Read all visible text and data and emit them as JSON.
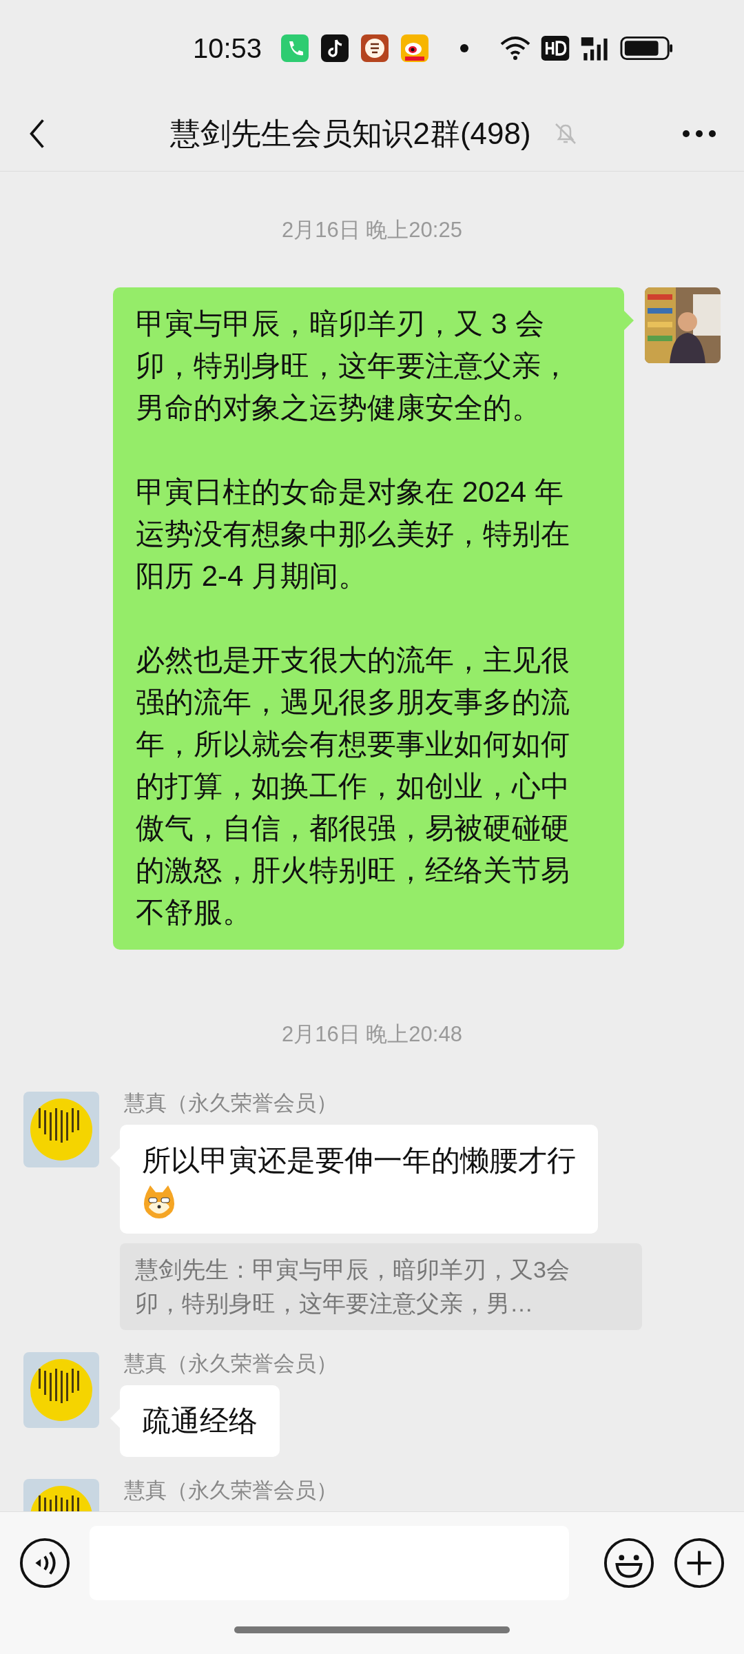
{
  "status_bar": {
    "time": "10:53"
  },
  "header": {
    "title": "慧剑先生会员知识2群(498)",
    "muted": true
  },
  "messages": [
    {
      "kind": "timestamp",
      "text": "2月16日 晚上20:25"
    },
    {
      "kind": "outgoing",
      "paragraphs": [
        "甲寅与甲辰，暗卯羊刃，又 3 会卯，特别身旺，这年要注意父亲，男命的对象之运势健康安全的。",
        "甲寅日柱的女命是对象在 2024 年运势没有想象中那么美好，特别在阳历 2-4 月期间。",
        "必然也是开支很大的流年，主见很强的流年，遇见很多朋友事多的流年，所以就会有想要事业如何如何的打算，如换工作，如创业，心中傲气，自信，都很强，易被硬碰硬的激怒，肝火特别旺，经络关节易不舒服。"
      ]
    },
    {
      "kind": "timestamp",
      "text": "2月16日 晚上20:48"
    },
    {
      "kind": "incoming",
      "sender": "慧真（永久荣誉会员）",
      "text": "所以甲寅还是要伸一年的懒腰才行",
      "sticker": true,
      "quote": "慧剑先生：甲寅与甲辰，暗卯羊刃，又3会卯，特别身旺，这年要注意父亲，男…"
    },
    {
      "kind": "incoming",
      "sender": "慧真（永久荣誉会员）",
      "text": "疏通经络"
    },
    {
      "kind": "incoming",
      "sender": "慧真（永久荣誉会员）"
    }
  ]
}
